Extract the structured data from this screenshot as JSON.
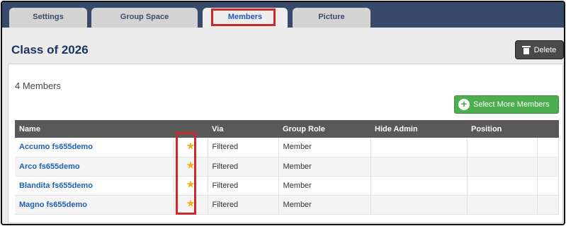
{
  "tabs": [
    {
      "label": "Settings",
      "active": false
    },
    {
      "label": "Group Space",
      "active": false
    },
    {
      "label": "Members",
      "active": true
    },
    {
      "label": "Picture",
      "active": false
    }
  ],
  "page": {
    "title": "Class of 2026",
    "delete_label": "Delete"
  },
  "members": {
    "count_text": "4 Members",
    "select_more_label": "Select More Members",
    "columns": [
      "Name",
      "",
      "Via",
      "Group Role",
      "Hide Admin",
      "Position",
      ""
    ],
    "rows": [
      {
        "name": "Accumo fs655demo",
        "starred": true,
        "via": "Filtered",
        "role": "Member",
        "hide_admin": "",
        "position": ""
      },
      {
        "name": "Arco fs655demo",
        "starred": true,
        "via": "Filtered",
        "role": "Member",
        "hide_admin": "",
        "position": ""
      },
      {
        "name": "Blandita fs655demo",
        "starred": true,
        "via": "Filtered",
        "role": "Member",
        "hide_admin": "",
        "position": ""
      },
      {
        "name": "Magno fs655demo",
        "starred": true,
        "via": "Filtered",
        "role": "Member",
        "hide_admin": "",
        "position": ""
      }
    ]
  },
  "colors": {
    "tabbar": "#374a6b",
    "title": "#1b355f",
    "link": "#1f5fb4",
    "green_button": "#4cae4c",
    "header_row": "#595959",
    "highlight": "#cc2a2a",
    "star": "#f2b01e"
  },
  "icons": {
    "delete": "trash-icon",
    "select_more": "plus-circle-icon",
    "starred": "star-icon"
  }
}
